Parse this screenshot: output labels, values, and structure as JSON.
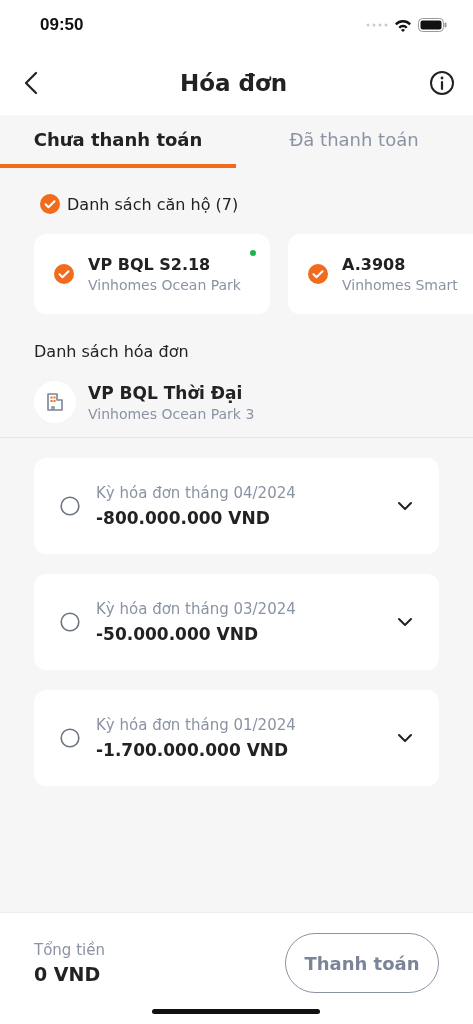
{
  "status_bar": {
    "time": "09:50"
  },
  "header": {
    "title": "Hóa đơn"
  },
  "tabs": [
    {
      "label": "Chưa thanh toán",
      "selected": true
    },
    {
      "label": "Đã thanh toán",
      "selected": false
    }
  ],
  "apartments": {
    "label": "Danh sách căn hộ (7)",
    "checked": true,
    "items": [
      {
        "name": "VP BQL S2.18",
        "project": "Vinhomes Ocean Park",
        "checked": true,
        "marked": true
      },
      {
        "name": "A.3908",
        "project": "Vinhomes Smart",
        "checked": true
      }
    ]
  },
  "invoices": {
    "label": "Danh sách hóa đơn",
    "building": {
      "name": "VP BQL Thời Đại",
      "project": "Vinhomes Ocean Park 3"
    },
    "items": [
      {
        "period": "Kỳ hóa đơn tháng 04/2024",
        "amount": "-800.000.000 VND",
        "selected": false,
        "expanded": false
      },
      {
        "period": "Kỳ hóa đơn tháng 03/2024",
        "amount": "-50.000.000 VND",
        "selected": false,
        "expanded": false
      },
      {
        "period": "Kỳ hóa đơn tháng 01/2024",
        "amount": "-1.700.000.000 VND",
        "selected": false,
        "expanded": false
      }
    ]
  },
  "footer": {
    "total_label": "Tổng tiền",
    "total": "0 VND",
    "button": {
      "label": "Thanh toán",
      "disabled": true
    }
  }
}
